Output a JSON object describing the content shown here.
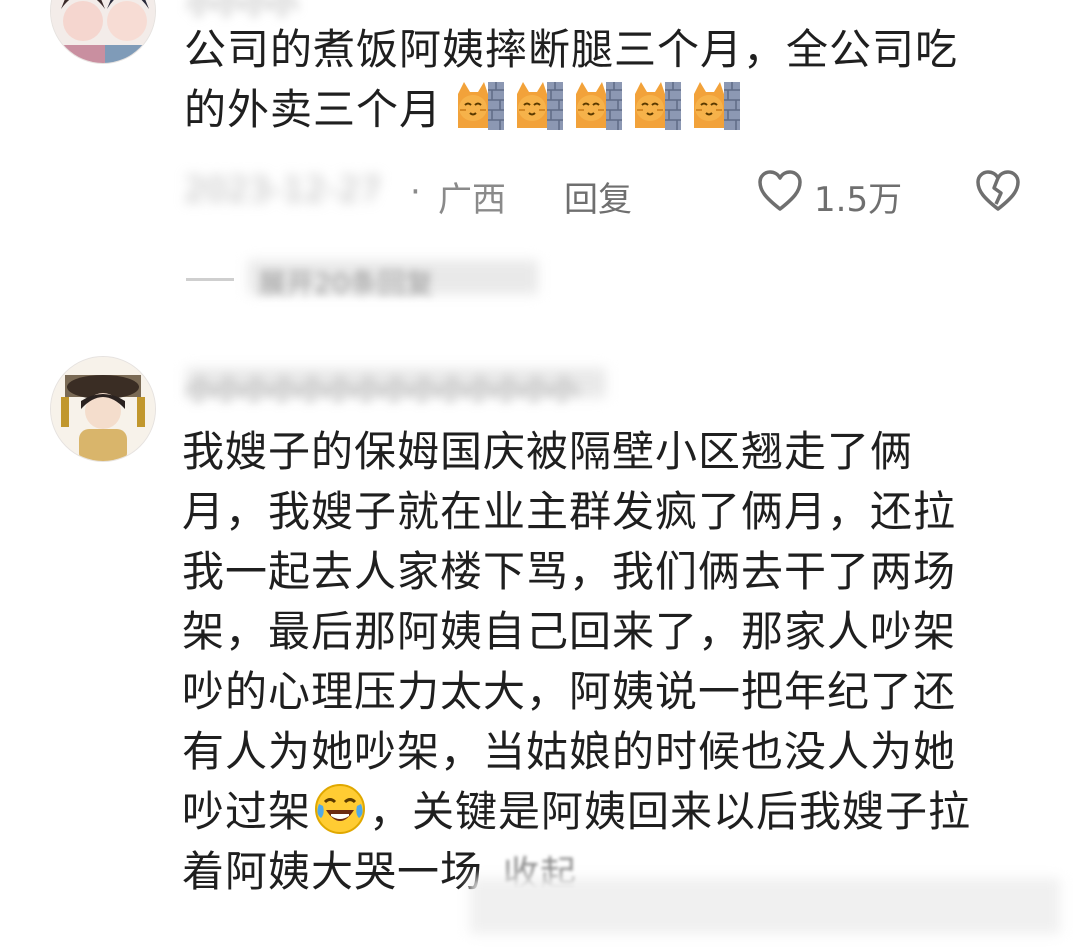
{
  "comment1": {
    "username": "小小小小",
    "text_lines": [
      "公司的煮饭阿姨摔断腿三个月，全公司吃",
      "的外卖三个月"
    ],
    "emoji": "cat-emoji",
    "emoji_count": 5,
    "date": "2023-12-27",
    "separator": "·",
    "location": "广西",
    "reply_label": "回复",
    "like_count": "1.5万",
    "expand_replies": "展开20条回复"
  },
  "comment2": {
    "username": "小小小小小小小小小小小小小小",
    "text_lines": [
      "我嫂子的保姆国庆被隔壁小区翘走了俩",
      "月，我嫂子就在业主群发疯了俩月，还拉",
      "我一起去人家楼下骂，我们俩去干了两场",
      "架，最后那阿姨自己回来了，那家人吵架",
      "吵的心理压力太大，阿姨说一把年纪了还",
      "有人为她吵架，当姑娘的时候也没人为她",
      "吵过架",
      "，关键是阿姨回来以后我嫂子拉",
      "着阿姨大哭一场"
    ],
    "collapse_label": "收起"
  },
  "colors": {
    "text": "#1f1f1f",
    "meta": "#8a8a8a",
    "background": "#ffffff"
  }
}
